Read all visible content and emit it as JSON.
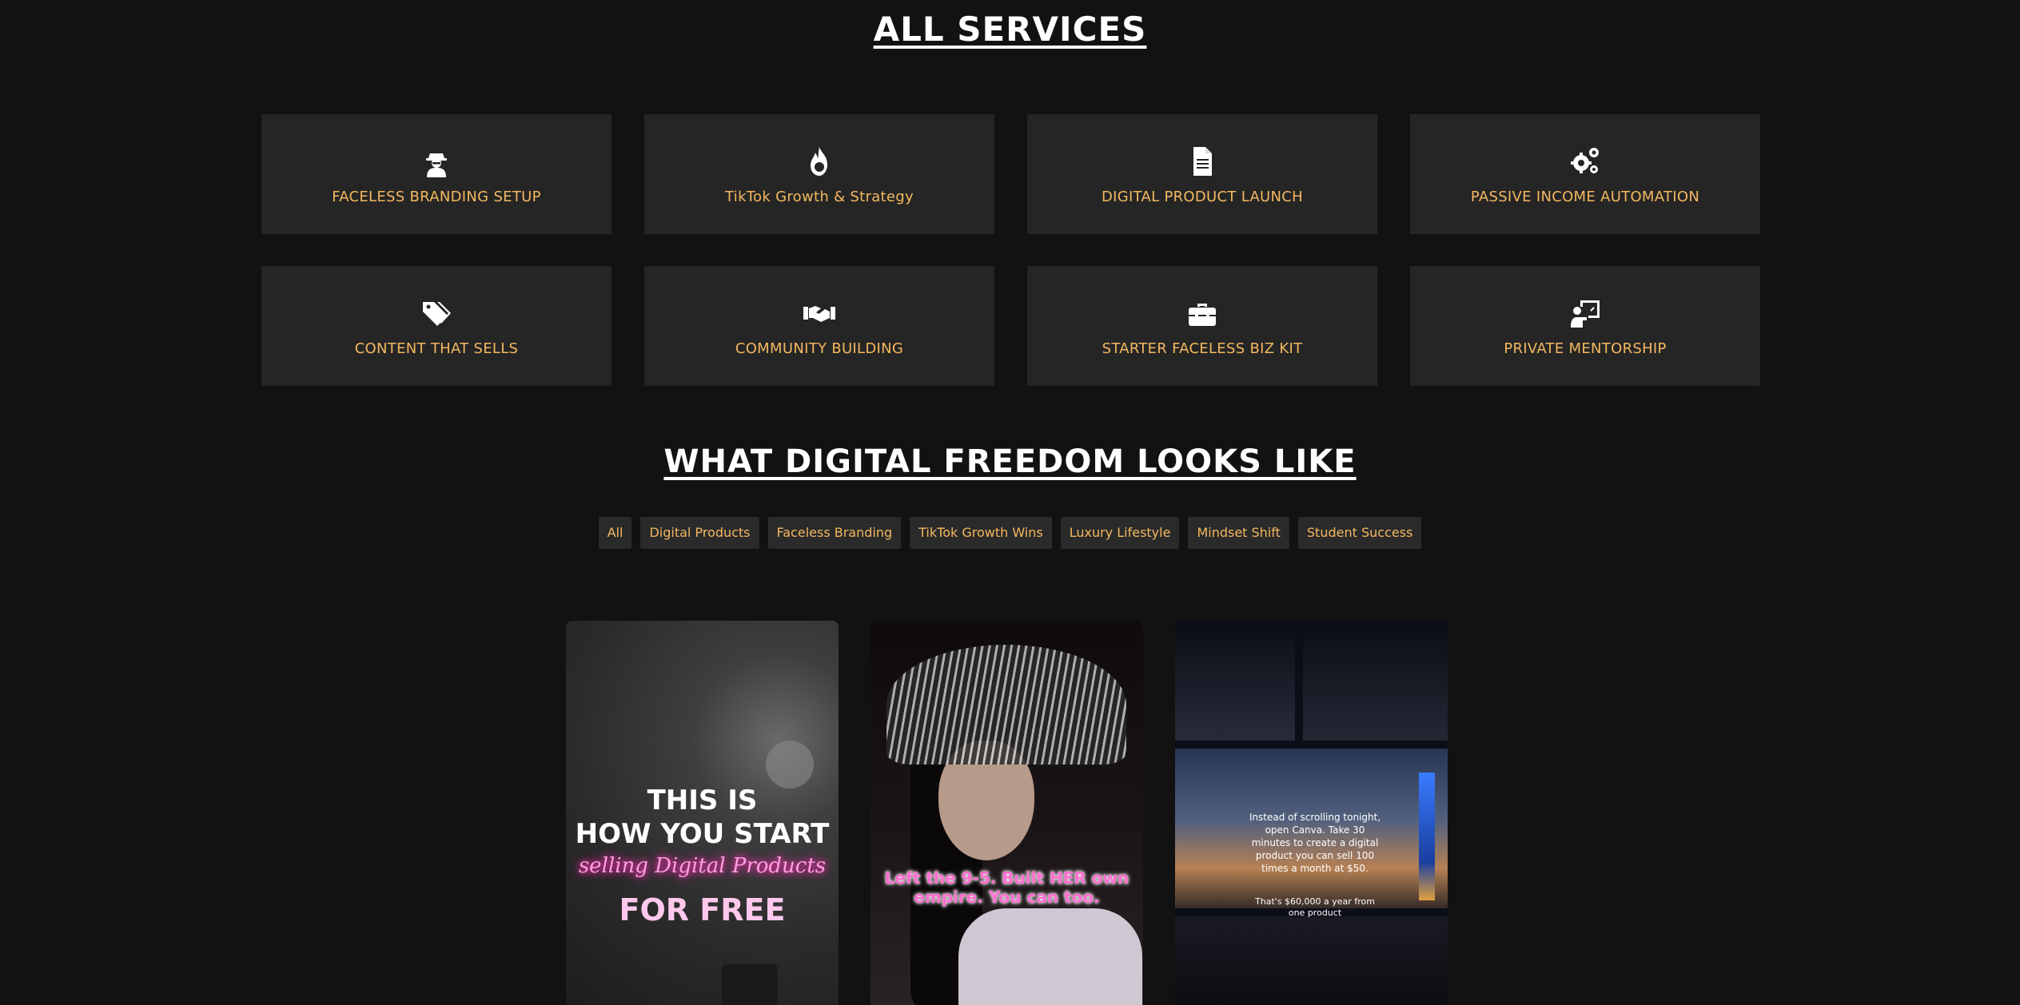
{
  "services": {
    "title": "ALL SERVICES",
    "items": [
      {
        "label": "FACELESS BRANDING SETUP",
        "icon": "user-secret-icon"
      },
      {
        "label": "TikTok Growth & Strategy",
        "icon": "fire-icon"
      },
      {
        "label": "DIGITAL PRODUCT LAUNCH",
        "icon": "file-icon"
      },
      {
        "label": "PASSIVE INCOME AUTOMATION",
        "icon": "gears-icon"
      },
      {
        "label": "CONTENT THAT SELLS",
        "icon": "tags-icon"
      },
      {
        "label": "COMMUNITY BUILDING",
        "icon": "handshake-icon"
      },
      {
        "label": "STARTER FACELESS BIZ KIT",
        "icon": "toolbox-icon"
      },
      {
        "label": "PRIVATE MENTORSHIP",
        "icon": "chalkboard-user-icon"
      }
    ]
  },
  "freedom": {
    "title": "WHAT DIGITAL FREEDOM LOOKS LIKE",
    "filters": [
      "All",
      "Digital Products",
      "Faceless Branding",
      "TikTok Growth Wins",
      "Luxury Lifestyle",
      "Mindset Shift",
      "Student Success"
    ]
  },
  "gallery": {
    "tile1": {
      "line1": "THIS IS",
      "line2": "HOW YOU START",
      "line3": "selling Digital Products",
      "line4": "FOR FREE"
    },
    "tile2": {
      "caption": "Left the 9-5. Built HER own empire. You can too."
    },
    "tile3": {
      "caption": "Instead of scrolling tonight, open Canva. Take 30 minutes to create a digital product you can sell 100 times a month at $50.",
      "caption2": "That's $60,000 a year from one product"
    }
  },
  "colors": {
    "background": "#121212",
    "card": "#252525",
    "accent": "#f4b860",
    "title": "#ffffff"
  }
}
